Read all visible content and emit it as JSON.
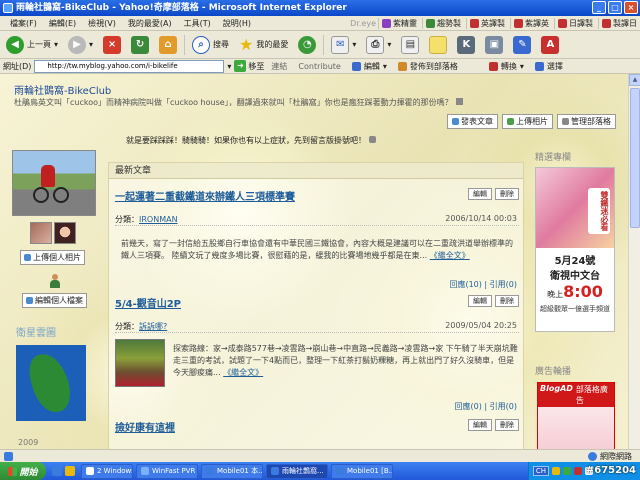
{
  "window": {
    "title": "雨輪社鵲窩-BikeClub - Yahoo!奇摩部落格 - Microsoft Internet Explorer"
  },
  "menu": {
    "items": [
      "檔案(F)",
      "編輯(E)",
      "檢視(V)",
      "我的最愛(A)",
      "工具(T)",
      "說明(H)"
    ],
    "links": [
      "紫精靈",
      "趨勢製",
      "英譯製",
      "紫譯英",
      "日譯製",
      "製譯日"
    ],
    "dreye": "Dr.eye"
  },
  "toolbar": {
    "back": "上一頁",
    "search": "搜尋",
    "favorites": "我的最愛"
  },
  "address": {
    "label": "網址(D)",
    "url": "http://tw.myblog.yahoo.com/i-bikelife",
    "go": "移至",
    "links": "連結",
    "contribute": "Contribute",
    "edit": "編輯",
    "post_blog": "發佈到部落格",
    "convert": "轉換",
    "select": "選擇"
  },
  "blog": {
    "title": "雨輪社鵲窩-BikeClub",
    "description": "杜鵑鳥英文叫「cuckoo」而精神病院叫做「cuckoo house」，翻譯過來就叫「杜鵑窩」你也是瘋狂踩著動力揮霍的那份嗎？",
    "actions": [
      "發表文章",
      "上傳相片",
      "管理部落格"
    ],
    "announcement": "就是要踩踩踩！騎騎騎！如果你也有以上症狀，先到留言版掛號吧！"
  },
  "left": {
    "upload_avatar": "上傳個人相片",
    "edit_profile": "編輯個人檔案",
    "heading": "衛星雲圖",
    "footer": "2009"
  },
  "main": {
    "header": "最新文章",
    "edit_label": "編輯",
    "delete_label": "刪除",
    "category_label": "分類：",
    "posts": [
      {
        "title": "一起運著二重截鐵道來辦鐵人三項標準賽",
        "category": "IRONMAN",
        "date": "2006/10/14 00:03",
        "body": "前幾天，寫了一封信給五股鄉自行車協會還有中華民國三鐵協會，內容大概是建議可以在二重疏洪道舉辦標準的鐵人三項賽。 陸續文玩了幾度多場比賽，很慰藉的是，緩我的比賽場地幾乎都是在東...",
        "more": "《繼全文》",
        "comments": "回應(10)",
        "trackback": "引用(0)"
      },
      {
        "title": "5/4-觀音山2P",
        "category": "訴訴哪?",
        "date": "2009/05/04 20:25",
        "body": "探索路線：家→成泰路577巷→凌雲路→崩山巷→中直路→民義路→凌雲路→家 下午騎了半天崩坑難走三重的考試，試題了一下4點而已，整理一下紅茶打鬍奶粿糖，再上就出門了好久沒騎車，但是今天腳痠痛...",
        "more": "《繼全文》",
        "comments": "回應(0)",
        "trackback": "引用(0)"
      },
      {
        "title": "撿好康有這裡"
      }
    ]
  },
  "right": {
    "heading_top": "精選專欄",
    "heading_bottom": "廣告輪播",
    "ad_badge": "雙鐵迷必看",
    "ad_day": "5月24號",
    "ad_channel": "衛視中文台",
    "ad_time_prefix": "晚上",
    "ad_time": "8:00",
    "ad_sub": "超級觀眾一億選手頻道",
    "blogad_brand": "BlogAD",
    "blogad_label": "部落格廣告"
  },
  "status": {
    "zone": "網際網路"
  },
  "taskbar": {
    "start": "開始",
    "tasks": [
      "2 Windows...",
      "WinFast PVR",
      "Mobile01 本...",
      "雨輪社鵲窩...",
      "Mobile01 [B..."
    ],
    "lang": "CH",
    "watermark": "#675204"
  },
  "colors": {
    "titlebar": "#0a47c7",
    "link": "#1f5d9a",
    "taskbar": "#2157d9"
  }
}
